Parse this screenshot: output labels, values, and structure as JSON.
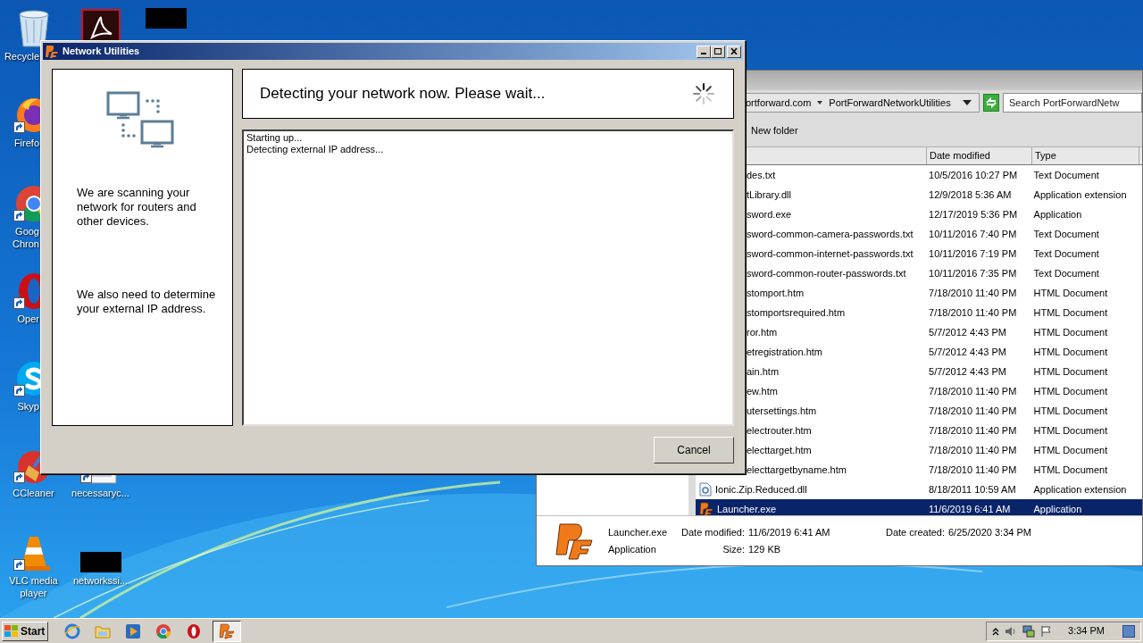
{
  "desktop": {
    "icons": [
      {
        "kind": "recycle",
        "lines": [
          "Recycle"
        ]
      },
      {
        "kind": "firefox",
        "lines": [
          "Firefo"
        ]
      },
      {
        "kind": "chrome",
        "lines": [
          "Goog",
          "Chron"
        ]
      },
      {
        "kind": "opera",
        "lines": [
          "Oper"
        ]
      },
      {
        "kind": "skype",
        "lines": [
          "Skyp"
        ]
      },
      {
        "kind": "ccleaner",
        "lines": [
          "CCleaner"
        ]
      },
      {
        "kind": "vlc",
        "lines": [
          "VLC media",
          "player"
        ]
      },
      {
        "kind": "pdf"
      },
      {
        "kind": "redacted"
      },
      {
        "kind": "document",
        "lines": [
          "necessaryc..."
        ]
      },
      {
        "kind": "redacted",
        "lines": [
          "networkssi..."
        ]
      }
    ]
  },
  "explorer": {
    "address": [
      "ortforward.com",
      "PortForwardNetworkUtilities"
    ],
    "search": {
      "placeholder": "Search PortForwardNetw"
    },
    "toolbar": [
      "New folder"
    ],
    "columns": [
      "Date modified",
      "Type"
    ],
    "rows": [
      {
        "kind": "clipped",
        "name": "des.txt",
        "date": "10/5/2016 10:27 PM",
        "type": "Text Document",
        "selected": false
      },
      {
        "kind": "clipped",
        "name": "tLibrary.dll",
        "date": "12/9/2018 5:36 AM",
        "type": "Application extension",
        "selected": false
      },
      {
        "kind": "clipped",
        "name": "sword.exe",
        "date": "12/17/2019 5:36 PM",
        "type": "Application",
        "selected": false
      },
      {
        "kind": "clipped",
        "name": "sword-common-camera-passwords.txt",
        "date": "10/11/2016 7:40 PM",
        "type": "Text Document",
        "selected": false
      },
      {
        "kind": "clipped",
        "name": "sword-common-internet-passwords.txt",
        "date": "10/11/2016 7:19 PM",
        "type": "Text Document",
        "selected": false
      },
      {
        "kind": "clipped",
        "name": "sword-common-router-passwords.txt",
        "date": "10/11/2016 7:35 PM",
        "type": "Text Document",
        "selected": false
      },
      {
        "kind": "clipped",
        "name": "stomport.htm",
        "date": "7/18/2010 11:40 PM",
        "type": "HTML Document",
        "selected": false
      },
      {
        "kind": "clipped",
        "name": "stomportsrequired.htm",
        "date": "7/18/2010 11:40 PM",
        "type": "HTML Document",
        "selected": false
      },
      {
        "kind": "clipped",
        "name": "ror.htm",
        "date": "5/7/2012 4:43 PM",
        "type": "HTML Document",
        "selected": false
      },
      {
        "kind": "clipped",
        "name": "etregistration.htm",
        "date": "5/7/2012 4:43 PM",
        "type": "HTML Document",
        "selected": false
      },
      {
        "kind": "clipped",
        "name": "ain.htm",
        "date": "5/7/2012 4:43 PM",
        "type": "HTML Document",
        "selected": false
      },
      {
        "kind": "clipped",
        "name": "ew.htm",
        "date": "7/18/2010 11:40 PM",
        "type": "HTML Document",
        "selected": false
      },
      {
        "kind": "clipped",
        "name": "utersettings.htm",
        "date": "7/18/2010 11:40 PM",
        "type": "HTML Document",
        "selected": false
      },
      {
        "kind": "clipped",
        "name": "electrouter.htm",
        "date": "7/18/2010 11:40 PM",
        "type": "HTML Document",
        "selected": false
      },
      {
        "kind": "clipped",
        "name": "electtarget.htm",
        "date": "7/18/2010 11:40 PM",
        "type": "HTML Document",
        "selected": false
      },
      {
        "kind": "clipped",
        "name": "electtargetbyname.htm",
        "date": "7/18/2010 11:40 PM",
        "type": "HTML Document",
        "selected": false
      },
      {
        "kind": "dll",
        "name": "Ionic.Zip.Reduced.dll",
        "date": "8/18/2011 10:59 AM",
        "type": "Application extension",
        "selected": false
      },
      {
        "kind": "app",
        "name": "Launcher.exe",
        "date": "11/6/2019 6:41 AM",
        "type": "Application",
        "selected": true
      }
    ],
    "details": {
      "name": "Launcher.exe",
      "type": "Application",
      "fields": [
        {
          "label": "Date modified:",
          "value": "11/6/2019 6:41 AM"
        },
        {
          "label": "Date created:",
          "value": "6/25/2020 3:34 PM"
        },
        {
          "label": "Size:",
          "value": "129 KB"
        }
      ]
    }
  },
  "dialog": {
    "title": "Network Utilities",
    "heading": "Detecting your network now. Please wait...",
    "info": [
      "We are scanning your network for routers and other devices.",
      "We also need to determine your external IP address."
    ],
    "log": [
      "Starting up...",
      "Detecting external IP address..."
    ],
    "buttons": [
      "Cancel"
    ]
  },
  "taskbar": {
    "start": "Start",
    "apps": [
      {
        "kind": "ie",
        "selected": false
      },
      {
        "kind": "folder",
        "selected": false
      },
      {
        "kind": "media",
        "selected": false
      },
      {
        "kind": "chrome",
        "selected": false
      },
      {
        "kind": "opera",
        "selected": false
      },
      {
        "kind": "pf",
        "selected": true
      }
    ],
    "clock": "3:34 PM"
  }
}
